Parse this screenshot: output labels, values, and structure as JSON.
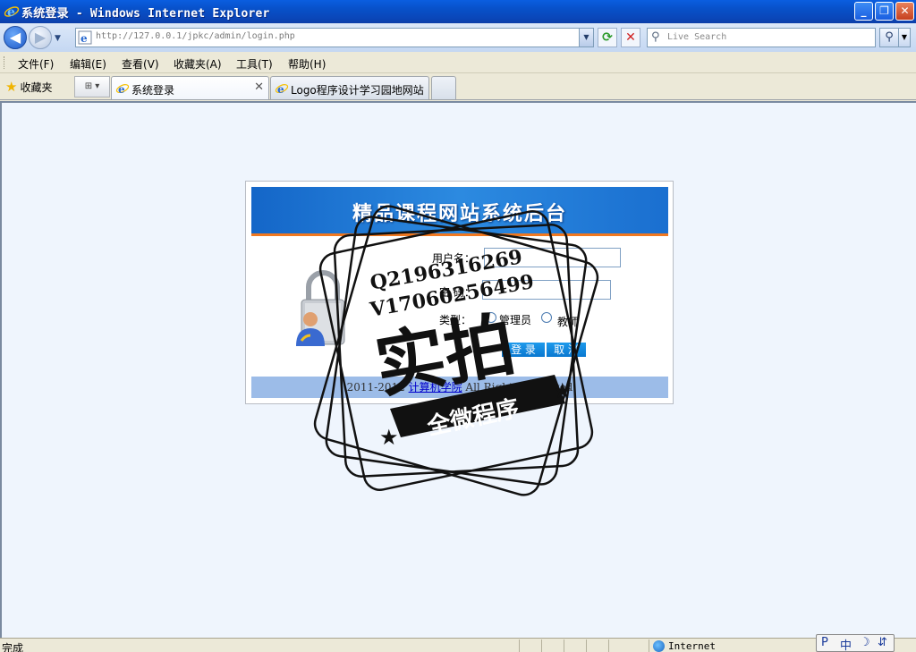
{
  "window": {
    "title": "系统登录 - Windows Internet Explorer",
    "minimize": "_",
    "restore": "❐",
    "close": "✕"
  },
  "toolbar": {
    "back_icon": "back-arrow-icon",
    "back": "◀",
    "forward": "▶",
    "nav_dropdown": "▼",
    "url": "http://127.0.0.1/jpkc/admin/login.php",
    "refresh": "⟳",
    "stop": "✕",
    "search_placeholder": "Live Search",
    "search_go": "⚲"
  },
  "menu": {
    "items": [
      "文件(F)",
      "编辑(E)",
      "查看(V)",
      "收藏夹(A)",
      "工具(T)",
      "帮助(H)"
    ]
  },
  "tabs": {
    "favorites_label": "收藏夹",
    "tab_group_icon": "⊞ ▾",
    "items": [
      {
        "label": "系统登录",
        "active": true
      },
      {
        "label": "Logo程序设计学习园地网站",
        "active": false
      }
    ],
    "close_glyph": "✕"
  },
  "login": {
    "banner_title": "精品课程网站系统后台",
    "username_label": "用户名：",
    "username_value": "",
    "password_label": "密 码：",
    "password_value": "",
    "type_label": "类型：",
    "type_options": [
      "管理员",
      "教师"
    ],
    "login_button": "登 录",
    "cancel_button": "取 消",
    "footer_prefix": "2011-2012 ",
    "footer_link": "计算机学院",
    "footer_suffix": " All Rights Reserved"
  },
  "watermark": {
    "line1": "Q2196316269",
    "line2": "V17060256499",
    "big_text": "实拍",
    "ribbon_text": "全微程序"
  },
  "statusbar": {
    "status": "完成",
    "zone": "Internet"
  },
  "ime": {
    "items": [
      "P",
      "中",
      "☽",
      "⇵"
    ]
  },
  "colors": {
    "banner_blue": "#1466c8",
    "banner_stripe": "#f07820",
    "footer_bar": "#9cbce8",
    "content_bg": "#eff5fd"
  }
}
